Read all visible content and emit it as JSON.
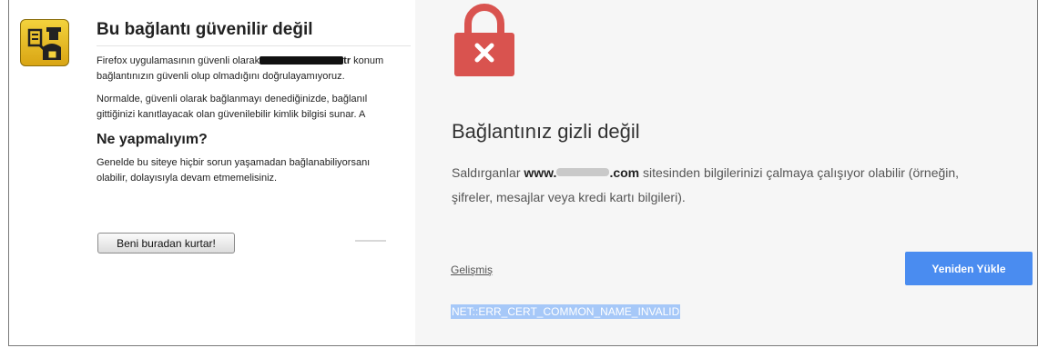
{
  "firefox": {
    "title": "Bu bağlantı güvenilir değil",
    "para1_pre": "Firefox uygulamasının güvenli olarak",
    "para1_mid": "tr",
    "para1_post": "konum",
    "para1_line2": "bağlantınızın güvenli olup olmadığını doğrulayamıyoruz.",
    "para2_line1": "Normalde, güvenli olarak bağlanmayı denediğinizde, bağlanıl",
    "para2_line2": "gittiğinizi kanıtlayacak olan güvenilebilir kimlik bilgisi sunar. A",
    "subtitle": "Ne yapmalıyım?",
    "para3_line1": "Genelde bu siteye hiçbir sorun yaşamadan bağlanabiliyorsanı",
    "para3_line2": "olabilir, dolayısıyla devam etmemelisiniz.",
    "button_label": "Beni buradan kurtar!",
    "icon": "police-officer-icon"
  },
  "chrome": {
    "title": "Bağlantınız gizli değil",
    "desc_pre": "Saldırganlar",
    "domain_start": "www.",
    "domain_end": ".com",
    "desc_post": "sitesinden bilgilerinizi çalmaya çalışıyor olabilir (örneğin,",
    "desc_line2": "şifreler, mesajlar veya kredi kartı bilgileri).",
    "advanced_link": "Gelişmiş",
    "reload_button": "Yeniden Yükle",
    "error_code": "NET::ERR_CERT_COMMON_NAME_INVALID",
    "icon": "lock-error-icon",
    "colors": {
      "lock": "#d9534f",
      "button": "#4a8cf0",
      "selection": "#a6c8f8"
    }
  }
}
